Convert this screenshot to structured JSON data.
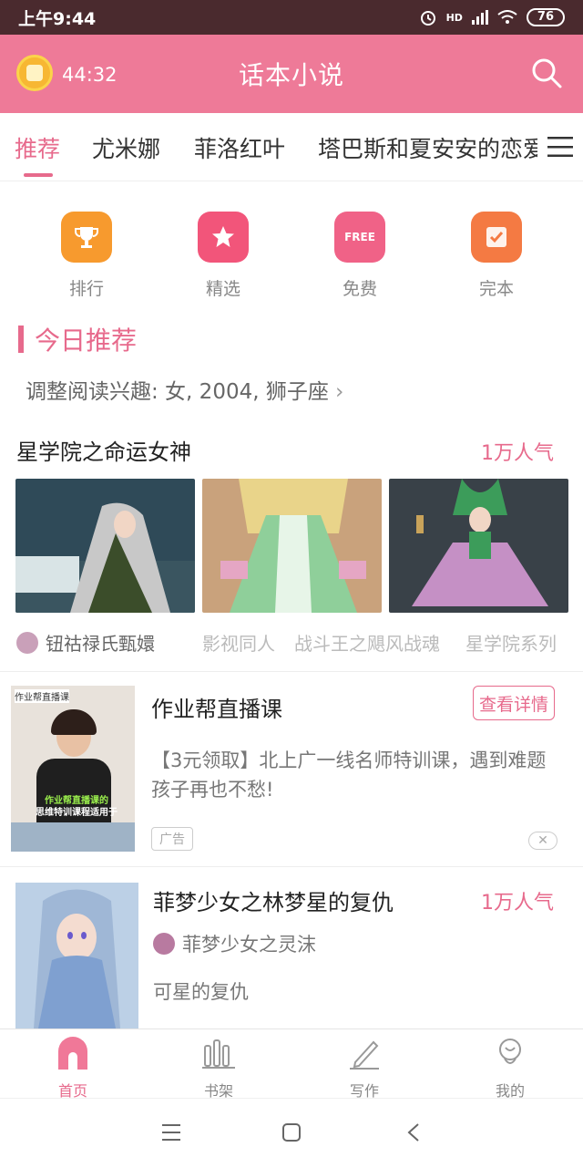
{
  "status": {
    "time": "上午9:44",
    "battery": "76",
    "network": "HD"
  },
  "header": {
    "timer": "44:32",
    "title": "话本小说"
  },
  "tabs": [
    {
      "label": "推荐"
    },
    {
      "label": "尤米娜"
    },
    {
      "label": "菲洛红叶"
    },
    {
      "label": "塔巴斯和夏安安的恋爱"
    }
  ],
  "quick": [
    {
      "label": "排行",
      "icon": "trophy-icon",
      "color": "#f79a2e"
    },
    {
      "label": "精选",
      "icon": "star-icon",
      "color": "#f2557a"
    },
    {
      "label": "免费",
      "icon": "free-icon",
      "icon_text": "FREE",
      "color": "#f06287"
    },
    {
      "label": "完本",
      "icon": "check-icon",
      "color": "#f47a43"
    }
  ],
  "section": {
    "title": "今日推荐",
    "interest": "调整阅读兴趣: 女, 2004, 狮子座"
  },
  "book1": {
    "title": "星学院之命运女神",
    "popularity": "1万人气",
    "author": "钮祜禄氏甄嬛",
    "tags": [
      "影视同人",
      "战斗王之飓风战魂",
      "星学院系列"
    ]
  },
  "ad": {
    "title": "作业帮直播课",
    "button": "查看详情",
    "desc": "【3元领取】北上广一线名师特训课，遇到难题孩子再也不愁!",
    "tag": "广告",
    "image_label": "作业帮直播课",
    "image_caption1": "作业帮直播课的",
    "image_caption2": "思维特训课程适用于"
  },
  "book2": {
    "title": "菲梦少女之林梦星的复仇",
    "popularity": "1万人气",
    "author": "菲梦少女之灵沫",
    "desc": "可星的复仇"
  },
  "tabbar": [
    {
      "label": "首页",
      "icon": "home-icon"
    },
    {
      "label": "书架",
      "icon": "bookshelf-icon"
    },
    {
      "label": "写作",
      "icon": "pen-icon"
    },
    {
      "label": "我的",
      "icon": "profile-icon"
    }
  ],
  "colors": {
    "accent": "#e76a8c",
    "header": "#ee7a98",
    "statusbar": "#4a2a2e"
  }
}
